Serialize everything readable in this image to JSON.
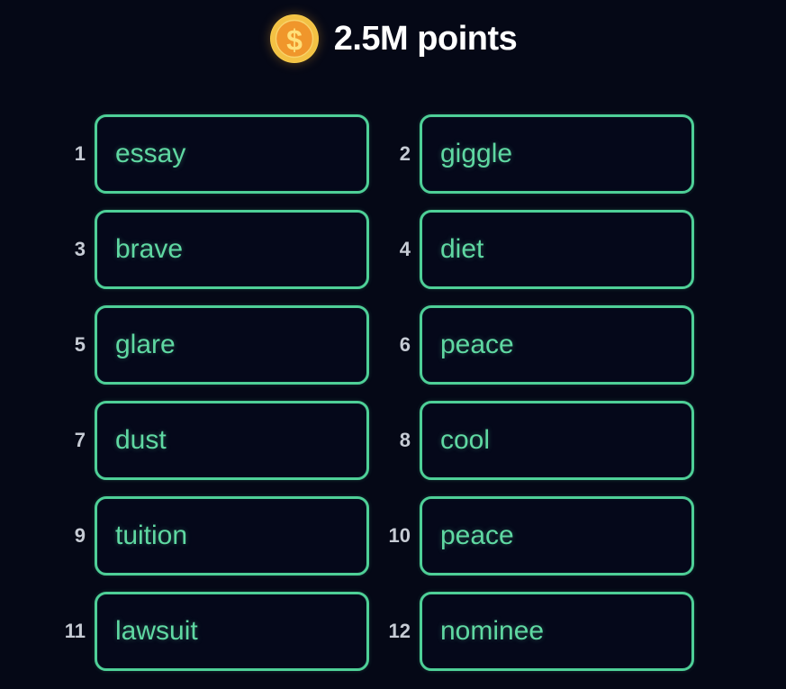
{
  "header": {
    "coin_icon": "coin-dollar-icon",
    "points_text": "2.5M points",
    "coin_colors": {
      "outer_ring": "#f6cc4a",
      "inner_disc": "#f0962b",
      "symbol": "#ffe07a"
    }
  },
  "theme": {
    "background": "#050816",
    "box_border": "#4ecf97",
    "word_text": "#5fd8a2",
    "index_text": "#c6cbd4",
    "header_text": "#ffffff"
  },
  "words": [
    {
      "index": "1",
      "word": "essay"
    },
    {
      "index": "2",
      "word": "giggle"
    },
    {
      "index": "3",
      "word": "brave"
    },
    {
      "index": "4",
      "word": "diet"
    },
    {
      "index": "5",
      "word": "glare"
    },
    {
      "index": "6",
      "word": "peace"
    },
    {
      "index": "7",
      "word": "dust"
    },
    {
      "index": "8",
      "word": "cool"
    },
    {
      "index": "9",
      "word": "tuition"
    },
    {
      "index": "10",
      "word": "peace"
    },
    {
      "index": "11",
      "word": "lawsuit"
    },
    {
      "index": "12",
      "word": "nominee"
    }
  ]
}
